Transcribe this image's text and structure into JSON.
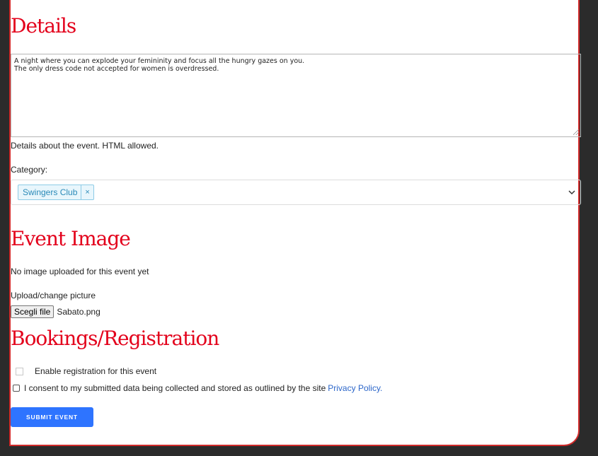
{
  "details": {
    "title": "Details",
    "text_line1": "A night where you can explode your femininity and focus all the hungry gazes on you.",
    "text_line2": "The only dress code not accepted for women is overdressed.",
    "help": "Details about the event. HTML allowed."
  },
  "category": {
    "label": "Category:",
    "selected_tag": "Swingers Club",
    "remove_symbol": "×"
  },
  "image": {
    "title": "Event Image",
    "no_image_text": "No image uploaded for this event yet",
    "upload_label": "Upload/change picture",
    "file_button": "Scegli file",
    "file_name": "Sabato.png"
  },
  "booking": {
    "title": "Bookings/Registration",
    "enable_label": "Enable registration for this event",
    "consent_text": "I consent to my submitted data being collected and stored as outlined by the site",
    "privacy_link": "Privacy Policy.",
    "submit_label": "SUBMIT EVENT"
  },
  "colors": {
    "heading": "#e3001b",
    "border": "#d12a2a",
    "button": "#2e74ff",
    "tag_bg": "#e8f6fc",
    "link": "#2c66c9"
  }
}
